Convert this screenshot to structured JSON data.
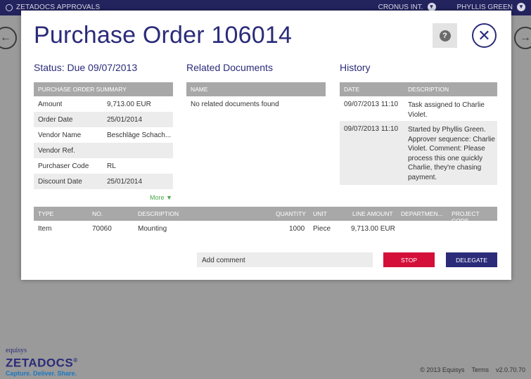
{
  "topbar": {
    "app_title": "ZETADOCS APPROVALS",
    "company": "CRONUS INT.",
    "user": "PHYLLIS GREEN"
  },
  "modal": {
    "title": "Purchase Order 106014",
    "help_label": "?",
    "close_label": "✕"
  },
  "status": "Status: Due 09/07/2013",
  "summary": {
    "header": "PURCHASE ORDER SUMMARY",
    "rows": [
      {
        "label": "Amount",
        "value": "9,713.00 EUR"
      },
      {
        "label": "Order Date",
        "value": "25/01/2014"
      },
      {
        "label": "Vendor Name",
        "value": "Beschläge Schach..."
      },
      {
        "label": "Vendor Ref.",
        "value": ""
      },
      {
        "label": "Purchaser Code",
        "value": "RL"
      },
      {
        "label": "Discount Date",
        "value": "25/01/2014"
      }
    ],
    "more": "More ▼"
  },
  "related": {
    "title": "Related Documents",
    "header": "NAME",
    "empty": "No related documents found"
  },
  "history": {
    "title": "History",
    "headers": {
      "date": "DATE",
      "description": "DESCRIPTION"
    },
    "rows": [
      {
        "date": "09/07/2013 11:10",
        "text": "Task assigned to Charlie Violet."
      },
      {
        "date": "09/07/2013 11:10",
        "text": "Started by Phyllis Green. Approver sequence: Charlie Violet. Comment: Please process this one quickly Charlie, they're chasing payment."
      }
    ]
  },
  "lines": {
    "headers": {
      "type": "TYPE",
      "no": "NO.",
      "description": "DESCRIPTION",
      "quantity": "QUANTITY",
      "unit": "UNIT",
      "line_amount": "LINE AMOUNT",
      "department": "DEPARTMEN...",
      "project": "PROJECT CODE"
    },
    "rows": [
      {
        "type": "Item",
        "no": "70060",
        "description": "Mounting",
        "quantity": "1000",
        "unit": "Piece",
        "line_amount": "9,713.00 EUR",
        "department": "",
        "project": ""
      }
    ]
  },
  "actions": {
    "comment_placeholder": "Add comment",
    "stop": "STOP",
    "delegate": "DELEGATE"
  },
  "footer": {
    "brand_small": "equisys",
    "brand_name": "ZETADOCS",
    "brand_reg": "®",
    "tagline": "Capture. Deliver. Share.",
    "copyright": "© 2013 Equisys",
    "terms": "Terms",
    "version": "v2.0.70.70"
  },
  "colors": {
    "brand": "#2b2b7a",
    "stop": "#d4103a",
    "more": "#4aa84a"
  },
  "icons": {
    "download": "download-icon",
    "help": "help-icon",
    "close": "close-icon",
    "prev": "arrow-left-icon",
    "next": "arrow-right-icon"
  }
}
